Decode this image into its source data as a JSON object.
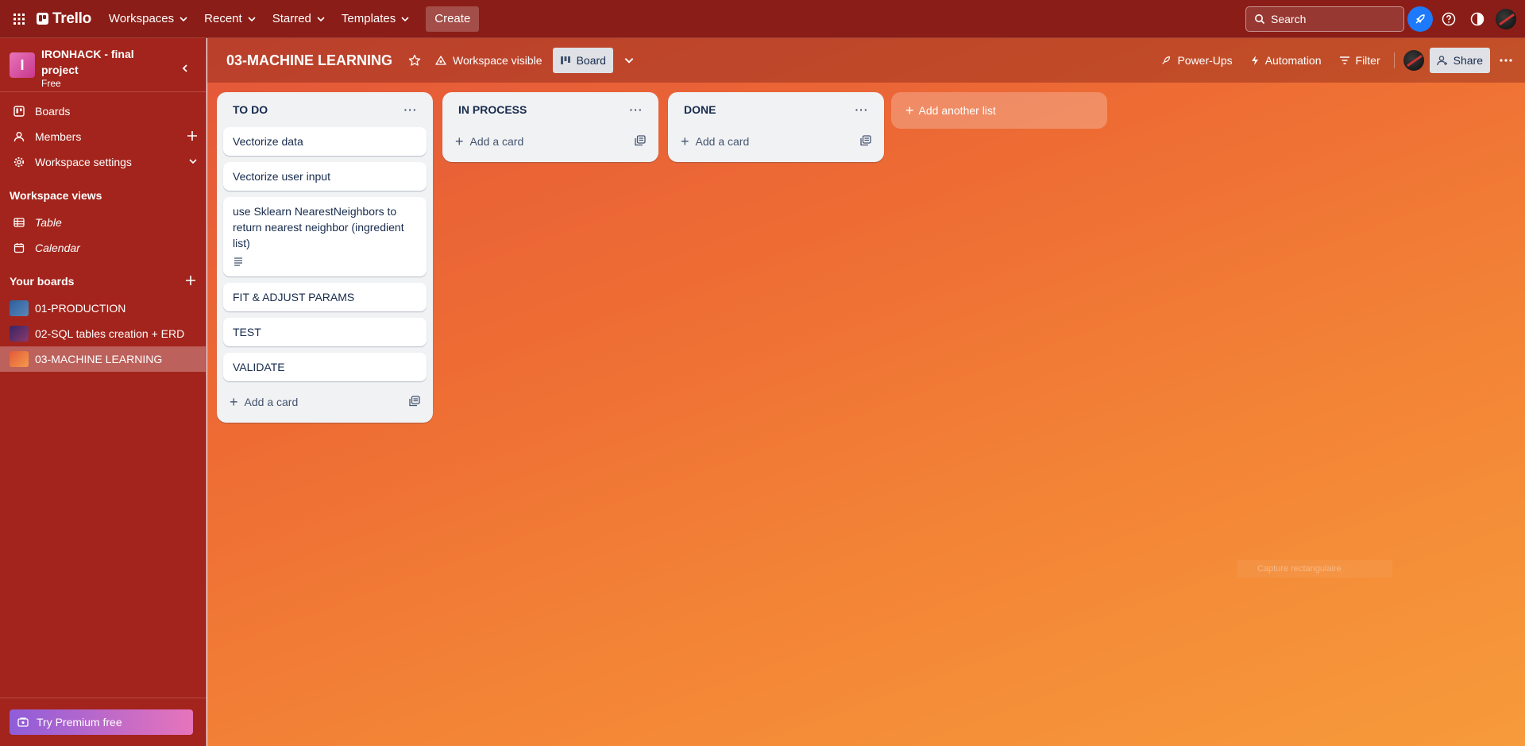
{
  "topnav": {
    "logo": "Trello",
    "menus": [
      "Workspaces",
      "Recent",
      "Starred",
      "Templates"
    ],
    "create": "Create",
    "search_placeholder": "Search"
  },
  "sidebar": {
    "workspace_name": "IRONHACK - final project",
    "workspace_initial": "I",
    "workspace_plan": "Free",
    "items": [
      {
        "label": "Boards",
        "icon": "boards-icon"
      },
      {
        "label": "Members",
        "icon": "person-icon"
      },
      {
        "label": "Workspace settings",
        "icon": "gear-icon"
      }
    ],
    "views_title": "Workspace views",
    "views": [
      {
        "label": "Table",
        "icon": "table-icon"
      },
      {
        "label": "Calendar",
        "icon": "calendar-icon"
      }
    ],
    "boards_title": "Your boards",
    "boards": [
      {
        "label": "01-PRODUCTION",
        "color": "#3b6aa8"
      },
      {
        "label": "02-SQL tables creation + ERD",
        "color": "#6b2d6b"
      },
      {
        "label": "03-MACHINE LEARNING",
        "color": "#ef7c45"
      }
    ],
    "premium": "Try Premium free"
  },
  "board": {
    "title": "03-MACHINE LEARNING",
    "visibility": "Workspace visible",
    "view": "Board",
    "powerups": "Power-Ups",
    "automation": "Automation",
    "filter": "Filter",
    "share": "Share",
    "add_list": "Add another list"
  },
  "lists": [
    {
      "title": "TO DO",
      "cards": [
        "Vectorize data",
        "Vectorize user input",
        "use Sklearn NearestNeighbors to return nearest neighbor (ingredient list)",
        "FIT & ADJUST PARAMS",
        "TEST",
        "VALIDATE"
      ],
      "add_card": "Add a card"
    },
    {
      "title": "IN PROCESS",
      "cards": [],
      "add_card": "Add a card"
    },
    {
      "title": "DONE",
      "cards": [],
      "add_card": "Add a card"
    }
  ],
  "overlay": {
    "capture": "Capture rectangulaire"
  },
  "colors": {
    "topnav": "#8a1d17",
    "sidebar": "#a3241c",
    "board_gradient_start": "#e3573a",
    "board_gradient_end": "#f79b3b",
    "list_bg": "#f1f2f4",
    "accent_blue": "#1d7afc"
  }
}
